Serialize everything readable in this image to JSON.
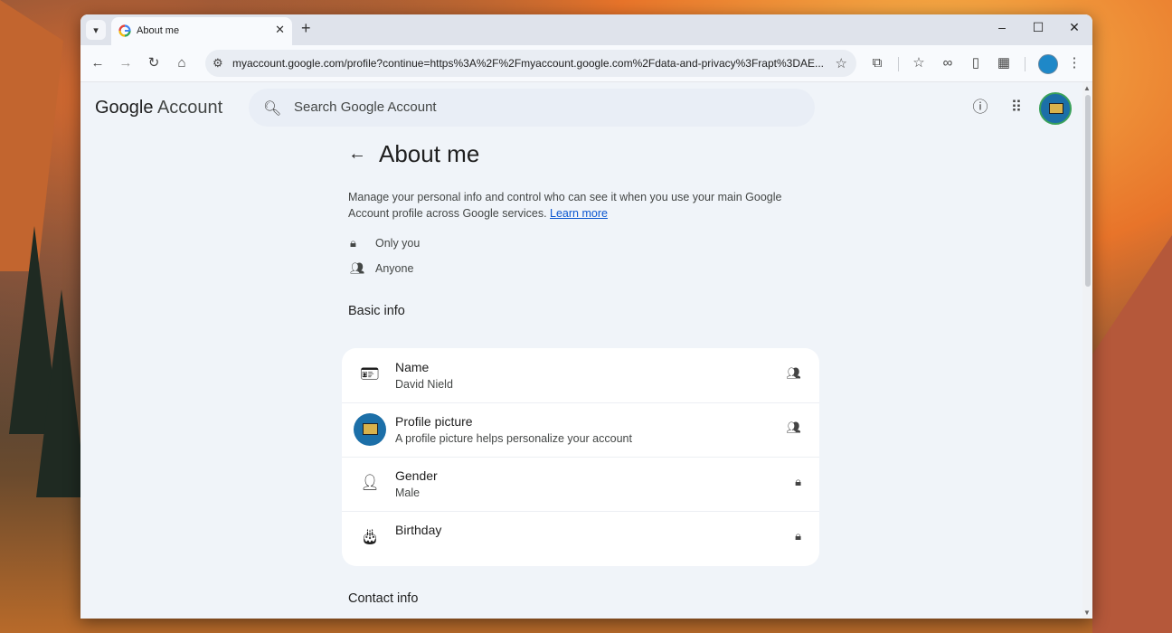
{
  "browser": {
    "tab_title": "About me",
    "url": "myaccount.google.com/profile?continue=https%3A%2F%2Fmyaccount.google.com%2Fdata-and-privacy%3Frapt%3DAE..."
  },
  "header": {
    "logo_google": "Google",
    "logo_account": "Account",
    "search_placeholder": "Search Google Account"
  },
  "main": {
    "title": "About me",
    "description": "Manage your personal info and control who can see it when you use your main Google Account profile across Google services.",
    "learn_more": "Learn more",
    "legend": [
      {
        "icon": "lock-icon",
        "label": "Only you"
      },
      {
        "icon": "people-icon",
        "label": "Anyone"
      }
    ],
    "basic_info_heading": "Basic info",
    "rows": [
      {
        "label": "Name",
        "value": "David Nield",
        "visibility": "people-icon"
      },
      {
        "label": "Profile picture",
        "value": "A profile picture helps personalize your account",
        "visibility": "people-icon"
      },
      {
        "label": "Gender",
        "value": "Male",
        "visibility": "lock-icon"
      },
      {
        "label": "Birthday",
        "value": "",
        "visibility": "lock-icon"
      }
    ],
    "contact_info_heading": "Contact info"
  },
  "colors": {
    "link": "#0b57d0",
    "page_bg": "#f0f4f9",
    "card_bg": "#ffffff"
  }
}
